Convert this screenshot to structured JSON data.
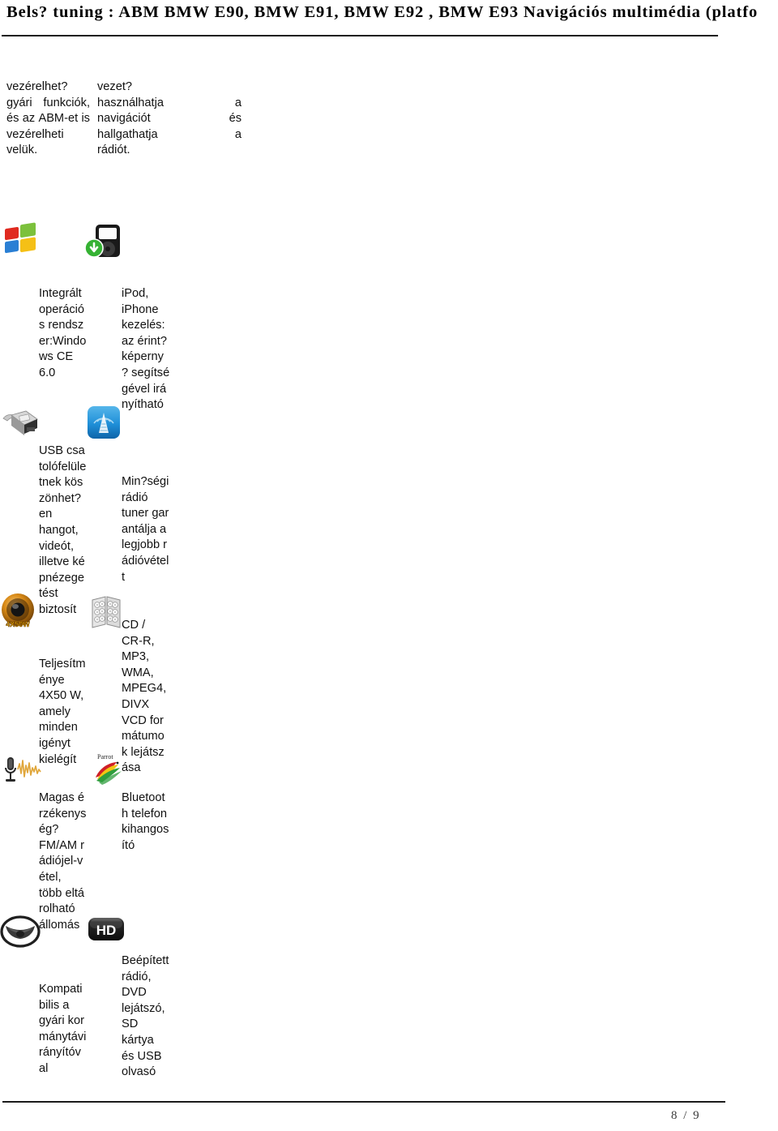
{
  "header": {
    "title": "Bels? tuning : ABM BMW E90, BMW E91, BMW E92 , BMW E93 Navigációs multimédia (platfo"
  },
  "footer": {
    "page_indicator": "8 / 9"
  },
  "intro": {
    "left_column": [
      "vezérelhet?",
      "gyári   funkciók,",
      "és az ABM-et is",
      "vezérelheti",
      "velük."
    ],
    "right_column": [
      "vezet?",
      "használhatja    a",
      "navigációt     és",
      "hallgathatja    a",
      "rádiót."
    ]
  },
  "features": [
    {
      "icon": "windows-logo-icon",
      "text": "Integrált operáció s rendsz er:Windo ws CE 6.0",
      "lines": [
        "Integrált",
        "operáció",
        "s rendsz",
        "er:Windo",
        "ws CE",
        "6.0"
      ]
    },
    {
      "icon": "ipod-download-icon",
      "text": "iPod, iPhone kezelés: az érint? képerny ? segítsé gével irá nyítható",
      "lines": [
        "iPod,",
        "iPhone",
        "kezelés:",
        "az érint?",
        "képerny",
        "? segítsé",
        "gével irá",
        "nyítható"
      ]
    },
    {
      "icon": "usb-connector-icon",
      "text": "USB csa tolófelüle tnek kös zönhet? en hangot, videót, illetve ké pnézege tést biztosít",
      "lines": [
        "USB csa",
        "tolófelüle",
        "tnek kös",
        "zönhet?",
        "en",
        "hangot,",
        "videót,",
        "illetve ké",
        "pnézege",
        "tést",
        "biztosít"
      ]
    },
    {
      "icon": "radio-tower-icon",
      "text": "Min?ségi rádió tuner gar antálja a legjobb r ádióvétel t",
      "lines": [
        "Min?ségi",
        "rádió",
        "tuner gar",
        "antálja a",
        "legjobb r",
        "ádióvétel",
        "t"
      ]
    },
    {
      "icon": "speaker-4x50w-icon",
      "text": "Teljesítm énye 4X50 W, amely minden igényt kielégít",
      "lines": [
        "Teljesítm",
        "énye",
        "4X50 W,",
        "amely",
        "minden",
        "igényt",
        "kielégít"
      ]
    },
    {
      "icon": "cd-wallet-icon",
      "text": "CD / CR-R, MP3, WMA, MPEG4, DIVX VCD for mátumo k lejátsz ása",
      "lines": [
        "CD /",
        "CR-R,",
        "MP3,",
        "WMA,",
        "MPEG4,",
        "DIVX",
        "VCD for",
        "mátumo",
        "k lejátsz",
        "ása"
      ]
    },
    {
      "icon": "microphone-waveform-icon",
      "text": "Magas é rzékenys ég? FM/AM r ádiójel-v étel, több eltá rolható állomás",
      "lines": [
        "Magas é",
        "rzékenys",
        "ég?",
        "FM/AM r",
        "ádiójel-v",
        "étel,",
        "több eltá",
        "rolható",
        "állomás"
      ]
    },
    {
      "icon": "parrot-logo-icon",
      "text": "Bluetoot h telefon kihangos ító",
      "lines": [
        "Bluetoot",
        "h telefon",
        "kihangos",
        "ító"
      ]
    },
    {
      "icon": "steering-wheel-icon",
      "text": "Kompati bilis a gyári kor mánytávi rányítóv al",
      "lines": [
        "Kompati",
        "bilis a",
        "gyári kor",
        "mánytávi",
        "rányítóv",
        "al"
      ]
    },
    {
      "icon": "hd-badge-icon",
      "text": "Beépített rádió, DVD lejátszó, SD kártya és USB olvasó",
      "lines": [
        "Beépített",
        "rádió,",
        "DVD",
        "lejátszó,",
        "SD",
        "kártya",
        "és USB",
        "olvasó"
      ]
    }
  ],
  "colors": {
    "rule": "#1b1b1b",
    "text": "#111111",
    "footer_text": "#3a3a3a",
    "radio_icon_blue": "#1f8fd8",
    "speaker_orange": "#d98a16",
    "ipod_green": "#35b233",
    "parrot_red": "#cf2027",
    "parrot_green": "#2f9e3d",
    "parrot_yellow": "#f2c513"
  }
}
